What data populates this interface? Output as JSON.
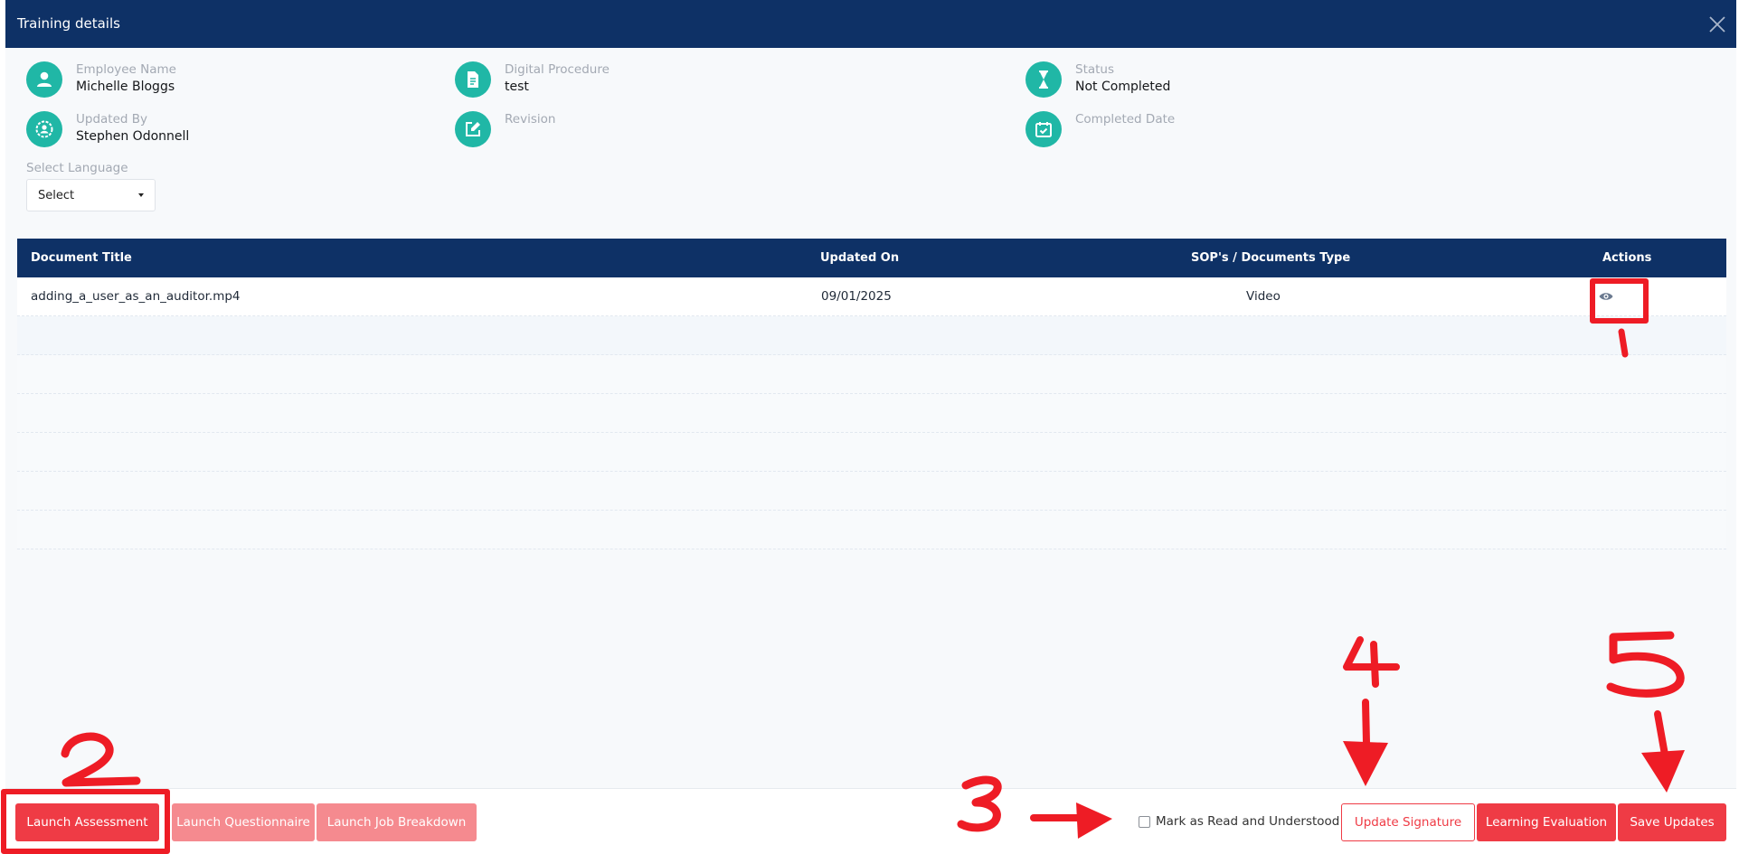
{
  "modal": {
    "title": "Training details"
  },
  "info": {
    "employee_name": {
      "label": "Employee Name",
      "value": "Michelle Bloggs",
      "icon": "user-icon"
    },
    "digital_procedure": {
      "label": "Digital Procedure",
      "value": "test",
      "icon": "document-icon"
    },
    "status": {
      "label": "Status",
      "value": "Not Completed",
      "icon": "hourglass-icon"
    },
    "updated_by": {
      "label": "Updated By",
      "value": "Stephen Odonnell",
      "icon": "user-gear-icon"
    },
    "revision": {
      "label": "Revision",
      "value": "",
      "icon": "edit-icon"
    },
    "completed_date": {
      "label": "Completed Date",
      "value": "",
      "icon": "calendar-check-icon"
    }
  },
  "language": {
    "label": "Select Language",
    "selected": "Select"
  },
  "table": {
    "headers": [
      "Document Title",
      "Updated On",
      "SOP's / Documents Type",
      "Actions"
    ],
    "rows": [
      {
        "title": "adding_a_user_as_an_auditor.mp4",
        "updated_on": "09/01/2025",
        "type": "Video",
        "action_icon": "eye-icon"
      }
    ]
  },
  "footer": {
    "launch_assessment": "Launch Assessment",
    "launch_questionnaire": "Launch Questionnaire",
    "launch_job_breakdown": "Launch Job Breakdown",
    "mark_read_label": "Mark as Read and Understood",
    "mark_read_checked": false,
    "update_signature": "Update Signature",
    "learning_evaluation": "Learning Evaluation",
    "save_updates": "Save Updates"
  },
  "annotations": {
    "color": "#ee1c25",
    "labels": [
      "1",
      "2",
      "3",
      "4",
      "5"
    ]
  },
  "colors": {
    "header_navy": "#0e3166",
    "teal": "#20b7a6",
    "accent_red": "#ef3b45",
    "pale_red": "#f58a8f"
  }
}
